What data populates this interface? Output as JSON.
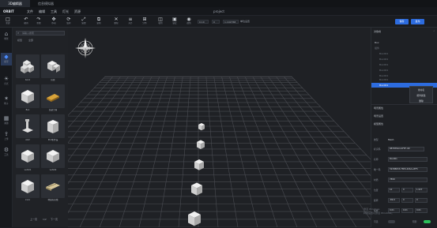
{
  "tabs": [
    "3D编辑器",
    "信息模拟器"
  ],
  "app": {
    "logo": "ORBIT",
    "project_title": "project"
  },
  "menu": [
    "文件",
    "编辑",
    "工具",
    "灯光",
    "资源"
  ],
  "toolbar": {
    "buttons": [
      {
        "label": "新建",
        "icon": "□"
      },
      {
        "label": "撤销",
        "icon": "↶"
      },
      {
        "label": "重做",
        "icon": "↷"
      },
      {
        "label": "移动",
        "icon": "✥"
      },
      {
        "label": "旋转",
        "icon": "⟳"
      },
      {
        "label": "缩放",
        "icon": "⤢"
      },
      {
        "label": "复制",
        "icon": "⧉"
      },
      {
        "label": "删除",
        "icon": "✕"
      },
      {
        "label": "对齐",
        "icon": "≡"
      },
      {
        "label": "分布",
        "icon": "⊞"
      },
      {
        "label": "吸附",
        "icon": "◫"
      },
      {
        "label": "锁定",
        "icon": "▣"
      },
      {
        "label": "视角",
        "icon": "◉"
      }
    ],
    "field1": "0.10",
    "field2": "0",
    "field3": "1.102768",
    "unit_label": "单位设置",
    "right_btn1": "保存",
    "right_btn2": "发布"
  },
  "left_strip": [
    {
      "label": "场景",
      "icon": "⌂"
    },
    {
      "label": "模型",
      "icon": "◆"
    },
    {
      "label": "灯光",
      "icon": "☀"
    },
    {
      "label": "粒子",
      "icon": "✶"
    },
    {
      "label": "资源",
      "icon": "▦"
    },
    {
      "label": "上传",
      "icon": "⇪"
    },
    {
      "label": "工具",
      "icon": "⚙"
    }
  ],
  "left_panel": {
    "search_placeholder": "请输入搜索",
    "subtabs": [
      "模型",
      "全部"
    ],
    "items": [
      "box1",
      "房屋",
      "Box",
      "混凝土墙",
      "AGV",
      "PLC柜外设",
      "vehi01",
      "vehi02",
      "xxxx",
      "地面标识线"
    ],
    "pager": {
      "prev": "上一页",
      "page": "1/2",
      "next": "下一页"
    }
  },
  "right_panel": {
    "tree_title": "对象树",
    "tree": [
      "Box",
      "组件",
      "Box001",
      "Box001",
      "Box001",
      "Box001",
      "Box001",
      "Box001",
      "Box001"
    ],
    "context_menu": [
      "重命名",
      "组件属性",
      "删除"
    ],
    "sections": [
      "场景属性",
      "场景设置",
      "模型属性"
    ],
    "subtabs": [
      "模型属性",
      "对象属性"
    ],
    "props": {
      "type_label": "类型",
      "type_value": "Mesh",
      "uuid_label": "标识码",
      "uuid_value": "6B7DE4A4-4F5F-4D",
      "name_label": "名称",
      "name_value": "Box001",
      "guid_label": "唯一码",
      "guid_value": "5938B833-F8E9-406A-AEF5",
      "material_label": "材质",
      "material_value": "7899",
      "pos_label": "位置",
      "pos": [
        "10",
        "0",
        "1.937"
      ],
      "rot_label": "旋转",
      "rot": [
        "-89.9",
        "0",
        "0"
      ],
      "scale_label": "缩放",
      "scale": [
        "0.01",
        "0.01",
        "0.01"
      ],
      "visible_label": "可见",
      "shadow_label": "阴影"
    },
    "watermark": [
      "激活 Windows",
      "转到设置以激活 Windows。"
    ]
  }
}
